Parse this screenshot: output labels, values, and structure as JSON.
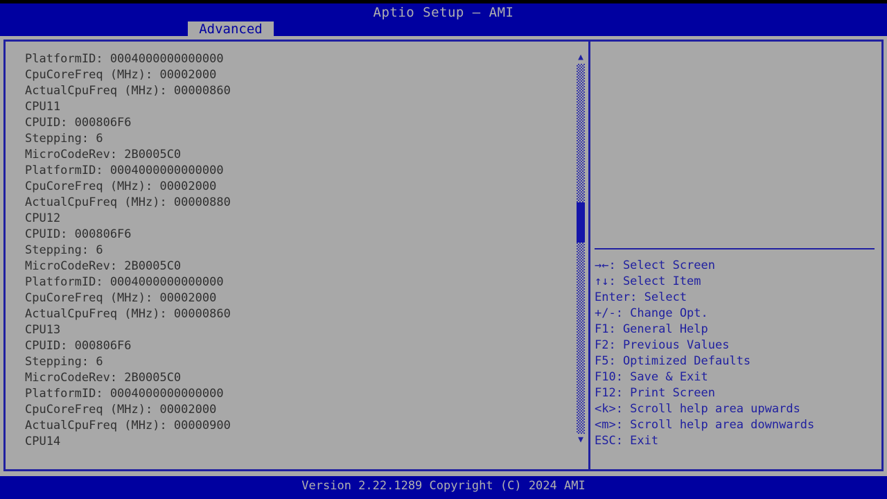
{
  "app": {
    "title": "Aptio Setup – AMI"
  },
  "tabs": [
    {
      "label": "Advanced",
      "active": true
    }
  ],
  "colors": {
    "header_bg": "#0000a0",
    "panel_bg": "#a8a8a8",
    "border": "#2020a0",
    "help_text": "#2020a0",
    "list_text": "#303030",
    "title_text": "#b0b0b0",
    "scrollbar_thumb": "#1515a8"
  },
  "main": {
    "lines": [
      "PlatformID: 0004000000000000",
      "CpuCoreFreq (MHz): 00002000",
      "ActualCpuFreq (MHz): 00000860",
      "CPU11",
      "CPUID: 000806F6",
      "Stepping: 6",
      "MicroCodeRev: 2B0005C0",
      "PlatformID: 0004000000000000",
      "CpuCoreFreq (MHz): 00002000",
      "ActualCpuFreq (MHz): 00000880",
      "CPU12",
      "CPUID: 000806F6",
      "Stepping: 6",
      "MicroCodeRev: 2B0005C0",
      "PlatformID: 0004000000000000",
      "CpuCoreFreq (MHz): 00002000",
      "ActualCpuFreq (MHz): 00000860",
      "CPU13",
      "CPUID: 000806F6",
      "Stepping: 6",
      "MicroCodeRev: 2B0005C0",
      "PlatformID: 0004000000000000",
      "CpuCoreFreq (MHz): 00002000",
      "ActualCpuFreq (MHz): 00000900",
      "CPU14"
    ]
  },
  "scrollbar": {
    "up_arrow": "▲",
    "down_arrow": "▼"
  },
  "help": {
    "items": [
      "→←: Select Screen",
      "↑↓: Select Item",
      "Enter: Select",
      "+/-: Change Opt.",
      "F1: General Help",
      "F2: Previous Values",
      "F5: Optimized Defaults",
      "F10: Save & Exit",
      "F12: Print Screen",
      "<k>: Scroll help area upwards",
      "<m>: Scroll help area downwards",
      "ESC: Exit"
    ]
  },
  "footer": {
    "version_text": "Version 2.22.1289 Copyright (C) 2024 AMI"
  }
}
